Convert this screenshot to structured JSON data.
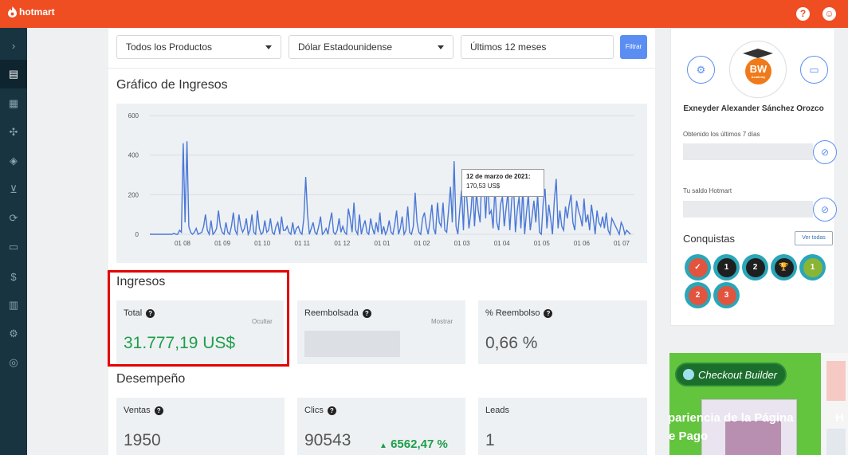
{
  "app": {
    "brand": "hotmart"
  },
  "topbar": {
    "help_icon": "question-circle-icon",
    "profile_icon": "user-icon"
  },
  "filters": {
    "product": "Todos los Productos",
    "currency": "Dólar Estadounidense",
    "period": "Últimos 12 meses",
    "button": "Filtrar"
  },
  "revenue_chart": {
    "title": "Gráfico de Ingresos",
    "tooltip_date": "12 de marzo de 2021:",
    "tooltip_value": "170,53 US$"
  },
  "chart_data": {
    "type": "line",
    "title": "Gráfico de Ingresos",
    "ylim": [
      0,
      600
    ],
    "yticks": [
      "0",
      "200",
      "400",
      "600"
    ],
    "xticks": [
      "01 08",
      "01 09",
      "01 10",
      "01 11",
      "01 12",
      "01 01",
      "01 02",
      "01 03",
      "01 04",
      "01 05",
      "01 06",
      "01 07"
    ],
    "grid": true,
    "series": [
      {
        "color": "#4a78d6",
        "values": [
          0,
          0,
          0,
          0,
          0,
          0,
          0,
          0,
          0,
          0,
          0,
          0,
          0,
          5,
          0,
          0,
          20,
          10,
          460,
          60,
          470,
          40,
          10,
          0,
          10,
          30,
          0,
          5,
          10,
          40,
          100,
          20,
          0,
          70,
          0,
          10,
          30,
          120,
          40,
          10,
          0,
          60,
          10,
          0,
          40,
          110,
          20,
          0,
          100,
          40,
          10,
          30,
          80,
          0,
          20,
          100,
          10,
          0,
          120,
          30,
          0,
          10,
          70,
          10,
          20,
          80,
          10,
          0,
          40,
          60,
          0,
          90,
          20,
          20,
          40,
          10,
          0,
          60,
          0,
          30,
          40,
          10,
          0,
          80,
          290,
          100,
          0,
          30,
          60,
          10,
          0,
          40,
          90,
          0,
          10,
          30,
          0,
          60,
          110,
          10,
          0,
          20,
          80,
          10,
          40,
          10,
          0,
          130,
          80,
          10,
          160,
          20,
          0,
          100,
          0,
          40,
          70,
          10,
          0,
          80,
          30,
          0,
          60,
          10,
          110,
          0,
          40,
          0,
          20,
          70,
          10,
          0,
          50,
          120,
          0,
          30,
          90,
          0,
          20,
          140,
          10,
          0,
          40,
          210,
          60,
          10,
          0,
          80,
          110,
          40,
          0,
          70,
          150,
          30,
          0,
          160,
          60,
          40,
          160,
          20,
          10,
          120,
          240,
          60,
          370,
          40,
          0,
          120,
          220,
          20,
          300,
          160,
          30,
          110,
          250,
          40,
          210,
          120,
          60,
          320,
          260,
          80,
          280,
          100,
          120,
          30,
          240,
          60,
          20,
          150,
          190,
          40,
          130,
          210,
          20,
          170,
          250,
          10,
          120,
          190,
          30,
          230,
          0,
          110,
          200,
          20,
          90,
          170,
          60,
          200,
          10,
          0,
          160,
          230,
          30,
          150,
          80,
          0,
          170,
          280,
          30,
          120,
          40,
          20,
          140,
          80,
          150,
          200,
          60,
          20,
          170,
          120,
          90,
          40,
          180,
          60,
          100,
          20,
          150,
          80,
          0,
          120,
          60,
          40,
          90,
          30,
          110,
          20,
          0,
          80,
          60,
          40,
          20,
          0,
          60,
          40,
          0,
          20,
          10,
          0
        ]
      }
    ]
  },
  "ingresos": {
    "title": "Ingresos",
    "total": {
      "label": "Total",
      "action": "Ocultar",
      "value": "31.777,19 US$"
    },
    "refund": {
      "label": "Reembolsada",
      "action": "Mostrar"
    },
    "refund_pct": {
      "label": "% Reembolso",
      "value": "0,66 %"
    }
  },
  "desempeno": {
    "title": "Desempeño",
    "sales": {
      "label": "Ventas",
      "value": "1950"
    },
    "clicks": {
      "label": "Clics",
      "value": "90543",
      "change": "6562,47 %"
    },
    "leads": {
      "label": "Leads",
      "value": "1"
    }
  },
  "profile": {
    "name": "Exneyder Alexander Sánchez Orozco",
    "avatar_text": "BW",
    "avatar_subtext": "Academy",
    "last7_label": "Obtenido los últimos 7 días",
    "balance_label": "Tu saldo Hotmart",
    "achievements_title": "Conquistas",
    "view_all": "Ver todas",
    "badges": [
      {
        "label": "✓",
        "color": "#e2543d"
      },
      {
        "label": "1",
        "color": "#1f1f1f"
      },
      {
        "label": "2",
        "color": "#1f1f1f"
      },
      {
        "label": "🏆",
        "color": "#1f1f1f"
      },
      {
        "label": "1",
        "color": "#8ab534"
      },
      {
        "label": "2",
        "color": "#e2543d"
      },
      {
        "label": "3",
        "color": "#e2543d"
      }
    ]
  },
  "ad": {
    "tag": "Checkout Builder",
    "headline_1": "pariencia de la Página",
    "headline_2": "e Pago",
    "side_text": "H"
  }
}
